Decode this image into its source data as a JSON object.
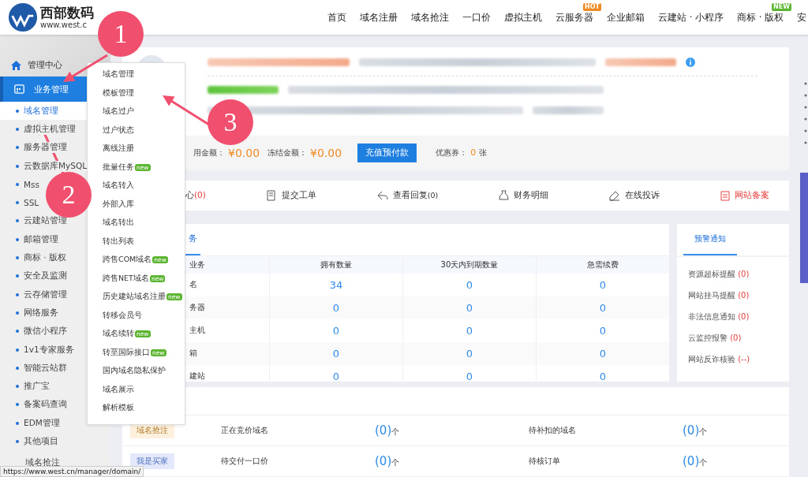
{
  "header": {
    "logo_title": "西部数码",
    "logo_url": "www.west.c",
    "nav": [
      {
        "label": "首页"
      },
      {
        "label": "域名注册"
      },
      {
        "label": "域名抢注"
      },
      {
        "label": "一口价"
      },
      {
        "label": "虚拟主机"
      },
      {
        "label": "云服务器",
        "badge": {
          "text": "HOT",
          "color": "#f08a24"
        }
      },
      {
        "label": "企业邮箱"
      },
      {
        "label": "云建站 · 小程序"
      },
      {
        "label": "商标 · 版权",
        "badge": {
          "text": "NEW",
          "color": "#5cb531"
        }
      },
      {
        "label": "安"
      }
    ]
  },
  "sidebar": {
    "home": "管理中心",
    "group": {
      "label": "业务管理",
      "selected": true
    },
    "items": [
      {
        "label": "域名管理",
        "selected": true
      },
      {
        "label": "虚拟主机管理",
        "selected": false
      },
      {
        "label": "服务器管理",
        "selected": false
      },
      {
        "label": "云数据库MySQL",
        "selected": false
      },
      {
        "label": "Mss",
        "selected": false
      },
      {
        "label": "SSL",
        "selected": false
      },
      {
        "label": "云建站管理",
        "selected": false
      },
      {
        "label": "邮箱管理",
        "selected": false
      },
      {
        "label": "商标 · 版权",
        "selected": false
      },
      {
        "label": "安全及监测",
        "selected": false
      },
      {
        "label": "云存储管理",
        "selected": false
      },
      {
        "label": "网络服务",
        "selected": false
      },
      {
        "label": "微信小程序",
        "selected": false
      },
      {
        "label": "1v1专家服务",
        "selected": false
      },
      {
        "label": "智能云站群",
        "selected": false
      },
      {
        "label": "推广宝",
        "selected": false
      },
      {
        "label": "备案码查询",
        "selected": false
      },
      {
        "label": "EDM管理",
        "selected": false
      },
      {
        "label": "其他项目",
        "selected": false
      }
    ],
    "next_group": "域名抢注"
  },
  "dropdown": [
    {
      "label": "域名管理"
    },
    {
      "label": "模板管理"
    },
    {
      "label": "域名过户"
    },
    {
      "label": "过户状态"
    },
    {
      "label": "离线注册"
    },
    {
      "label": "批量任务",
      "badge": "new"
    },
    {
      "label": "域名转入"
    },
    {
      "label": "外部入库"
    },
    {
      "label": "域名转出"
    },
    {
      "label": "转出列表"
    },
    {
      "label": "跨售COM域名",
      "badge": "new"
    },
    {
      "label": "跨售NET域名",
      "badge": "new"
    },
    {
      "label": "历史建站域名注册",
      "badge": "new"
    },
    {
      "label": "转移会员号"
    },
    {
      "label": "域名续转",
      "badge": "new"
    },
    {
      "label": "转至国际接口",
      "badge": "new"
    },
    {
      "label": "国内域名隐私保护"
    },
    {
      "label": "域名展示"
    },
    {
      "label": "解析模板"
    }
  ],
  "account": {
    "balance_label": "用金额：",
    "balance": "¥0.00",
    "frozen_label": "冻结金额：",
    "frozen": "¥0.00",
    "recharge_button": "充值预付款",
    "coupon_label": "优惠券：",
    "coupon_count": "0",
    "coupon_unit": "张"
  },
  "quick_links": [
    {
      "kind": "count",
      "label": "心",
      "count": "(0)"
    },
    {
      "kind": "plain",
      "label": "提交工单"
    },
    {
      "kind": "reply",
      "label": "查看回复",
      "count": "(0)"
    },
    {
      "kind": "plain",
      "label": "财务明细"
    },
    {
      "kind": "plain",
      "label": "在线投诉"
    },
    {
      "kind": "alert",
      "label": "网站备案"
    }
  ],
  "business": {
    "tab": "务",
    "columns": [
      "业务",
      "拥有数量",
      "30天内到期数量",
      "急需续费"
    ],
    "rows": [
      [
        "名",
        "34",
        "0",
        "0"
      ],
      [
        "务器",
        "0",
        "0",
        "0"
      ],
      [
        "主机",
        "0",
        "0",
        "0"
      ],
      [
        "箱",
        "0",
        "0",
        "0"
      ],
      [
        "建站",
        "0",
        "0",
        "0"
      ]
    ]
  },
  "warnings": {
    "tab": "预警通知",
    "items": [
      {
        "label": "资源超标提醒",
        "value": "(0)"
      },
      {
        "label": "网站挂马提醒",
        "value": "(0)"
      },
      {
        "label": "非法信息通知",
        "value": "(0)"
      },
      {
        "label": "云监控报警",
        "value": "(0)"
      },
      {
        "label": "网站反诈核验",
        "value": "(--)"
      }
    ]
  },
  "orders": [
    {
      "tag": "域名抢注",
      "color": "#fdf0dc",
      "label_1": "正在竞价域名",
      "value_1": "(0)",
      "unit_1": "个",
      "label_2": "待补扣的域名",
      "value_2": "(0)",
      "unit_2": "个"
    },
    {
      "tag": "我是买家",
      "color": "#e3e9fb",
      "label_1": "待交付一口价",
      "value_1": "(0)",
      "unit_1": "个",
      "label_2": "待核订单",
      "value_2": "(0)",
      "unit_2": "个"
    }
  ],
  "status_url": "https://www.west.cn/manager/domain/",
  "annotations": [
    "1",
    "2",
    "3"
  ]
}
